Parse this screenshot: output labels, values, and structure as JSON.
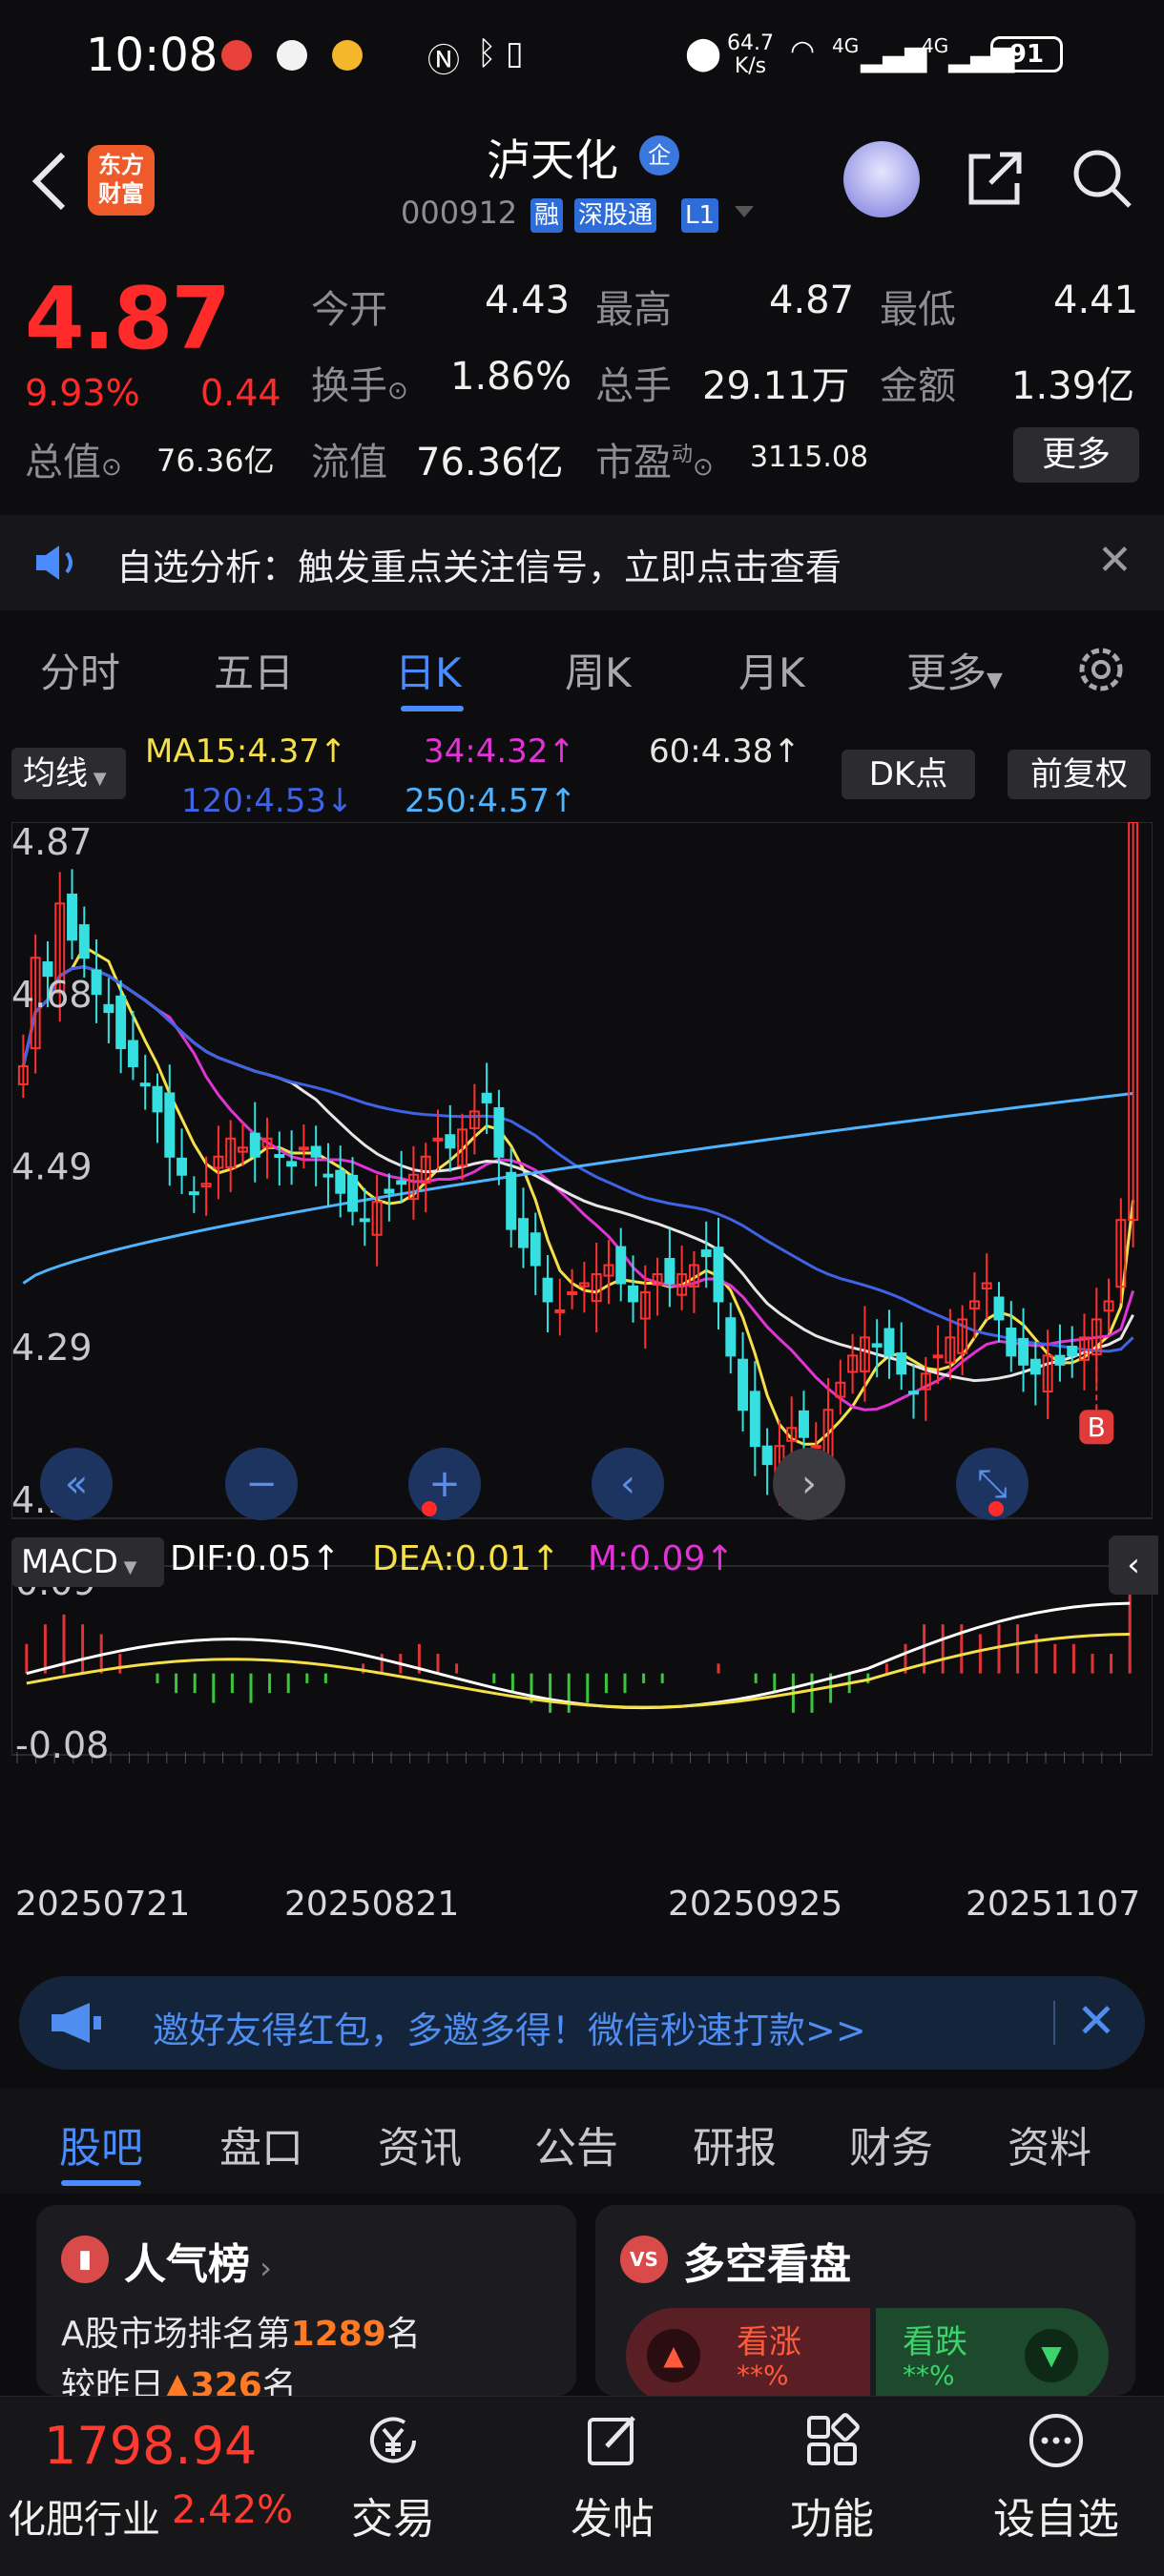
{
  "status_bar": {
    "time": "10:08",
    "net_speed_value": "64.7",
    "net_speed_unit": "K/s",
    "signal1": "4G",
    "signal2": "4G",
    "battery": "91"
  },
  "header": {
    "logo_line1": "东方",
    "logo_line2": "财富",
    "stock_name": "泸天化",
    "name_badge": "企",
    "stock_code": "000912",
    "tags": [
      "融",
      "深股通",
      "L1"
    ]
  },
  "quote": {
    "price": "4.87",
    "change_pct": "9.93%",
    "change": "0.44",
    "open_label": "今开",
    "open": "4.43",
    "high_label": "最高",
    "high": "4.87",
    "low_label": "最低",
    "low": "4.41",
    "turnover_label": "换手",
    "turnover": "1.86%",
    "volume_label": "总手",
    "volume": "29.11万",
    "amount_label": "金额",
    "amount": "1.39亿",
    "mcap_label": "总值",
    "mcap": "76.36亿",
    "float_label": "流值",
    "float": "76.36亿",
    "pe_label": "市盈",
    "pe_super": "动",
    "pe": "3115.08",
    "more_label": "更多"
  },
  "notice": {
    "text": "自选分析：触发重点关注信号，立即点击查看"
  },
  "period_tabs": [
    "分时",
    "五日",
    "日K",
    "周K",
    "月K",
    "更多"
  ],
  "active_period": "日K",
  "chart_header": {
    "ma_btn": "均线",
    "ma15": "MA15:4.37↑",
    "ma34": "34:4.32↑",
    "ma60": "60:4.38↑",
    "ma120": "120:4.53↓",
    "ma250": "250:4.57↑",
    "dk_btn": "DK点",
    "fq_btn": "前复权"
  },
  "colors": {
    "up": "#ff3030",
    "down": "#36e0e0",
    "ma15": "#f5e04a",
    "ma34": "#e233d6",
    "ma60": "#e6e6e6",
    "ma120": "#3f63e6",
    "ma250": "#4fb4ff",
    "macd_pos": "#e03535",
    "macd_neg": "#3bc63b"
  },
  "chart_data": {
    "type": "candlestick",
    "y_labels": [
      "4.87",
      "4.68",
      "4.49",
      "4.29",
      "4.10"
    ],
    "ylim": [
      4.1,
      4.87
    ],
    "x_labels": [
      "20250721",
      "20250821",
      "20250925",
      "20251107"
    ],
    "closes": [
      4.6,
      4.72,
      4.7,
      4.78,
      4.74,
      4.72,
      4.68,
      4.66,
      4.62,
      4.6,
      4.58,
      4.55,
      4.5,
      4.48,
      4.46,
      4.47,
      4.5,
      4.52,
      4.51,
      4.5,
      4.52,
      4.5,
      4.49,
      4.51,
      4.5,
      4.48,
      4.46,
      4.44,
      4.43,
      4.45,
      4.46,
      4.47,
      4.48,
      4.5,
      4.52,
      4.51,
      4.53,
      4.55,
      4.56,
      4.5,
      4.42,
      4.4,
      4.38,
      4.34,
      4.33,
      4.35,
      4.36,
      4.37,
      4.38,
      4.36,
      4.34,
      4.35,
      4.37,
      4.36,
      4.37,
      4.38,
      4.39,
      4.34,
      4.28,
      4.22,
      4.18,
      4.16,
      4.18,
      4.2,
      4.19,
      4.18,
      4.22,
      4.25,
      4.28,
      4.3,
      4.29,
      4.28,
      4.26,
      4.24,
      4.26,
      4.28,
      4.3,
      4.32,
      4.34,
      4.36,
      4.32,
      4.28,
      4.27,
      4.26,
      4.28,
      4.27,
      4.28,
      4.3,
      4.32,
      4.34,
      4.43,
      4.87
    ],
    "signal_marker": "B",
    "macd_labels": [
      "0.09",
      "-0.08"
    ],
    "macd_ylim": [
      -0.08,
      0.09
    ],
    "macd_hist": [
      0.03,
      0.05,
      0.06,
      0.05,
      0.04,
      0.02,
      0.0,
      -0.01,
      -0.02,
      -0.02,
      -0.03,
      -0.02,
      -0.03,
      -0.02,
      -0.02,
      -0.01,
      -0.01,
      0.0,
      0.01,
      0.02,
      0.02,
      0.03,
      0.02,
      0.01,
      0.0,
      -0.01,
      -0.02,
      -0.03,
      -0.04,
      -0.04,
      -0.03,
      -0.02,
      -0.02,
      -0.01,
      -0.01,
      0.0,
      0.0,
      0.01,
      0.0,
      -0.01,
      -0.02,
      -0.04,
      -0.04,
      -0.03,
      -0.02,
      -0.01,
      0.01,
      0.03,
      0.05,
      0.05,
      0.05,
      0.04,
      0.05,
      0.05,
      0.04,
      0.03,
      0.03,
      0.02,
      0.02,
      0.09
    ]
  },
  "macd_header": {
    "btn": "MACD",
    "dif": "DIF:0.05↑",
    "dea": "DEA:0.01↑",
    "m": "M:0.09↑"
  },
  "invite": {
    "text": "邀好友得红包，多邀多得！微信秒速打款>>"
  },
  "info_tabs": [
    "股吧",
    "盘口",
    "资讯",
    "公告",
    "研报",
    "财务",
    "资料"
  ],
  "cards": {
    "popularity_title": "人气榜",
    "rank_prefix": "A股市场排名第",
    "rank_value": "1289",
    "rank_suffix": "名",
    "rank_change_prefix": "较昨日",
    "rank_change_value": "▲326",
    "rank_change_suffix": "名",
    "ls_title": "多空看盘",
    "ls_icon": "VS",
    "up_label": "看涨",
    "up_value": "**%",
    "down_label": "看跌",
    "down_value": "**%"
  },
  "bottom_nav": {
    "index_value": "1798.94",
    "index_name": "化肥行业",
    "index_pct": "2.42%",
    "items": [
      "交易",
      "发帖",
      "功能",
      "设自选"
    ]
  }
}
